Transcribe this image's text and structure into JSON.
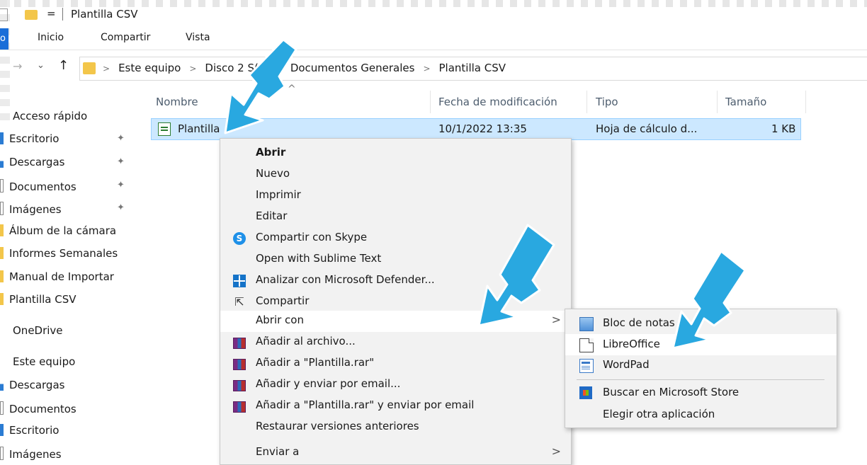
{
  "window": {
    "title": "Plantilla CSV",
    "quick_access_glyph": "="
  },
  "ribbon": {
    "file_tab": "o",
    "tabs": [
      "Inicio",
      "Compartir",
      "Vista"
    ]
  },
  "nav": {
    "back_icon": "→",
    "recent_icon": "⌄",
    "up_icon": "↑",
    "breadcrumb": [
      "Este equipo",
      "Disco 2 S(:)",
      "Documentos Generales",
      "Plantilla CSV"
    ]
  },
  "columns": {
    "name": "Nombre",
    "modified": "Fecha de modificación",
    "type": "Tipo",
    "size": "Tamaño"
  },
  "file": {
    "name": "Plantilla",
    "modified": "10/1/2022 13:35",
    "type": "Hoja de cálculo d...",
    "size": "1 KB"
  },
  "sidebar": {
    "quick_access": "Acceso rápido",
    "quick_items": [
      "Escritorio",
      "Descargas",
      "Documentos",
      "Imágenes",
      "Álbum de la cámara",
      "Informes Semanales",
      "Manual de Importar",
      "Plantilla CSV"
    ],
    "onedrive": "OneDrive",
    "this_pc": "Este equipo",
    "pc_items": [
      "Descargas",
      "Documentos",
      "Escritorio",
      "Imágenes"
    ]
  },
  "context_menu": [
    "Abrir",
    "Nuevo",
    "Imprimir",
    "Editar",
    "Compartir con Skype",
    "Open with Sublime Text",
    "Analizar con Microsoft Defender...",
    "Compartir",
    "Abrir con",
    "Añadir al archivo...",
    "Añadir a \"Plantilla.rar\"",
    "Añadir y enviar por email...",
    "Añadir a \"Plantilla.rar\" y enviar por email",
    "Restaurar versiones anteriores",
    "Enviar a"
  ],
  "open_with_submenu": [
    "Bloc de notas",
    "LibreOffice",
    "WordPad",
    "Buscar en Microsoft Store",
    "Elegir otra aplicación"
  ],
  "colors": {
    "selection": "#cce8ff",
    "arrow": "#29a8e0",
    "accent": "#1a6ed8"
  }
}
